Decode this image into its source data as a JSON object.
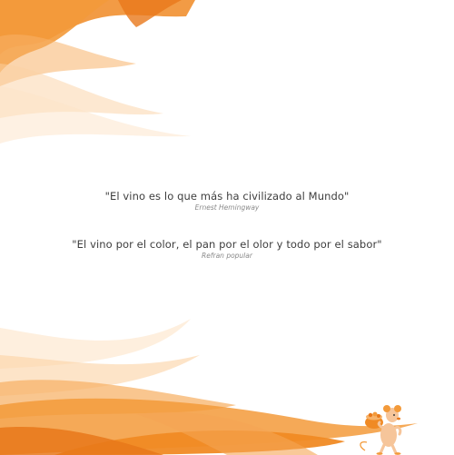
{
  "quotes": [
    {
      "text": "\"El vino es lo que más ha civilizado al Mundo\"",
      "author": "Ernest Hemingway"
    },
    {
      "text": "\"El vino por el color, el pan por el olor y todo por el sabor\"",
      "author": "Refran popular"
    }
  ],
  "colors": {
    "accent": "#f08a24",
    "accent_light": "#f7b36a",
    "text": "#3d3d3d",
    "muted": "#8a8a8a"
  },
  "decorations": {
    "top": "orange-wave-swoosh",
    "bottom": "orange-wave-swoosh",
    "mascot": "mouse-carrying-basket-illustration"
  }
}
